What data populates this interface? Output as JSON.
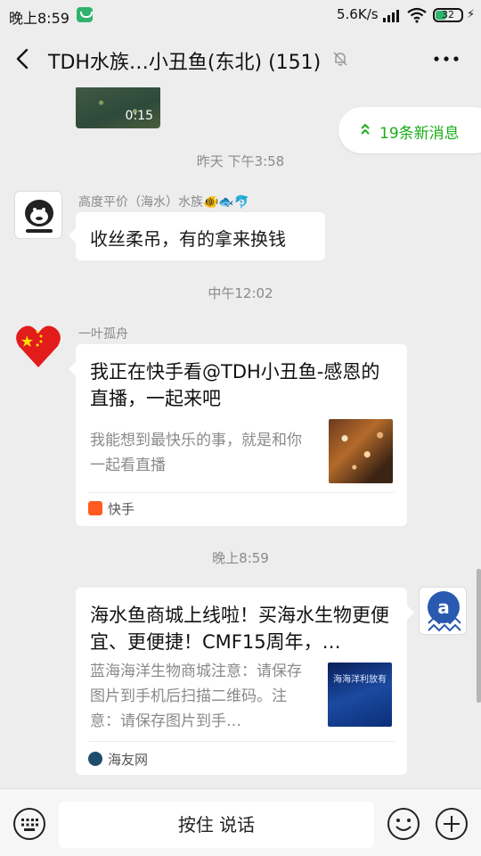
{
  "status_bar": {
    "time": "晚上8:59",
    "network_speed": "5.6K/s",
    "battery_level": "32",
    "icons": [
      "app-notification-icon",
      "signal-icon",
      "wifi-icon",
      "battery-icon",
      "charging-icon"
    ]
  },
  "nav": {
    "title": "TDH水族…小丑鱼(东北) (151)",
    "icons": [
      "back-icon",
      "mute-icon",
      "more-icon"
    ]
  },
  "chat": {
    "video_duration": "0:15",
    "new_messages": "19条新消息",
    "timestamps": [
      "昨天 下午3:58",
      "中午12:02",
      "晚上8:59"
    ],
    "messages": [
      {
        "sender": "高度平价（海水）水族🐠🐟🐬",
        "text": "收丝柔吊，有的拿来换钱"
      },
      {
        "sender": "一叶孤舟",
        "card_title": "我正在快手看@TDH小丑鱼-感恩的直播，一起来吧",
        "card_desc": "我能想到最快乐的事，就是和你一起看直播",
        "card_source": "快手"
      },
      {
        "card_title": "海水鱼商城上线啦！买海水生物更便宜、更便捷！CMF15周年，…",
        "card_desc": "蓝海海洋生物商城注意：请保存图片到手机后扫描二维码。注意：请保存图片到手…",
        "card_source": "海友网",
        "thumb_text": "海海洋利放有"
      }
    ]
  },
  "input_bar": {
    "hold_to_talk": "按住 说话",
    "icons": [
      "keyboard-icon",
      "emoji-icon",
      "plus-icon"
    ]
  },
  "colors": {
    "accent_green": "#1aad19",
    "background": "#ededed",
    "bubble": "#ffffff",
    "kuaishou_orange": "#ff5a1f"
  }
}
